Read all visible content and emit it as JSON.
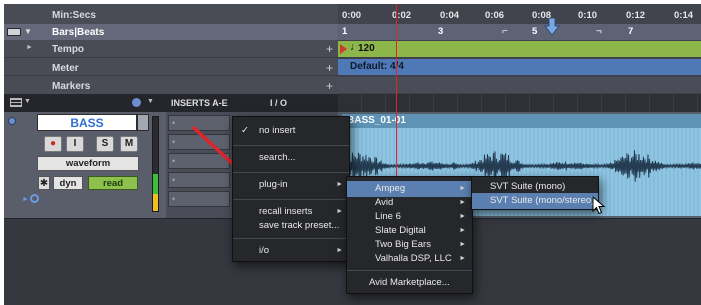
{
  "rulers": {
    "min_secs_label": "Min:Secs",
    "bars_beats_label": "Bars|Beats",
    "time_ticks": [
      "0:00",
      "0:02",
      "0:04",
      "0:06",
      "0:08",
      "0:10",
      "0:12",
      "0:14"
    ],
    "bar_ticks": [
      "1",
      "3",
      "5",
      "7"
    ]
  },
  "rows": {
    "tempo": {
      "label": "Tempo",
      "value": "120"
    },
    "meter": {
      "label": "Meter",
      "value": "Default: 4/4"
    },
    "markers": {
      "label": "Markers"
    },
    "add_symbol": "+"
  },
  "mix_header": {
    "inserts_label": "INSERTS A-E",
    "io_label": "I / O"
  },
  "track": {
    "name": "BASS",
    "view_mode": "waveform",
    "dyn_label": "dyn",
    "automation_mode": "read",
    "clip_name": "BASS_01-01",
    "buttons": {
      "record": "●",
      "input": "I",
      "solo": "S",
      "mute": "M"
    }
  },
  "insert_menu": {
    "no_insert": "no insert",
    "search": "search...",
    "plug_in": "plug-in",
    "recall_inserts": "recall inserts",
    "save_track_preset": "save track preset...",
    "io": "i/o",
    "checkmark": "✓"
  },
  "vendor_menu": {
    "items": [
      "Ampeg",
      "Avid",
      "Line 6",
      "Slate Digital",
      "Two Big Ears",
      "Valhalla DSP, LLC"
    ],
    "marketplace": "Avid Marketplace..."
  },
  "plugin_menu": {
    "items": [
      "SVT Suite (mono)",
      "SVT Suite (mono/stereo)"
    ]
  },
  "colors": {
    "tempo_bar": "#8cb64a",
    "meter_bar": "#4f78b6",
    "clip": "#8ec6e4",
    "arrow": "#e0242a",
    "menu_highlight": "#5a7fb0"
  }
}
